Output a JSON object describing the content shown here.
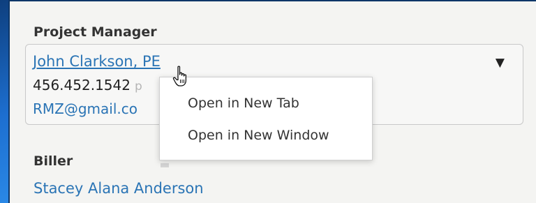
{
  "project_manager": {
    "label": "Project Manager",
    "name": "John Clarkson, PE",
    "phone": "456.452.1542",
    "phone_suffix": "p",
    "email": "RMZ@gmail.co",
    "dropdown_icon": "caret-down-icon"
  },
  "context_menu": {
    "items": [
      {
        "label": "Open in New Tab"
      },
      {
        "label": "Open in New Window"
      }
    ]
  },
  "biller": {
    "label": "Biller",
    "name": "Stacey Alana Anderson"
  },
  "cursor": {
    "icon": "hand-pointer-icon"
  },
  "colors": {
    "link": "#2a74b5",
    "panel_bg": "#f4f4f2",
    "accent_blue": "#1b5aa8"
  }
}
